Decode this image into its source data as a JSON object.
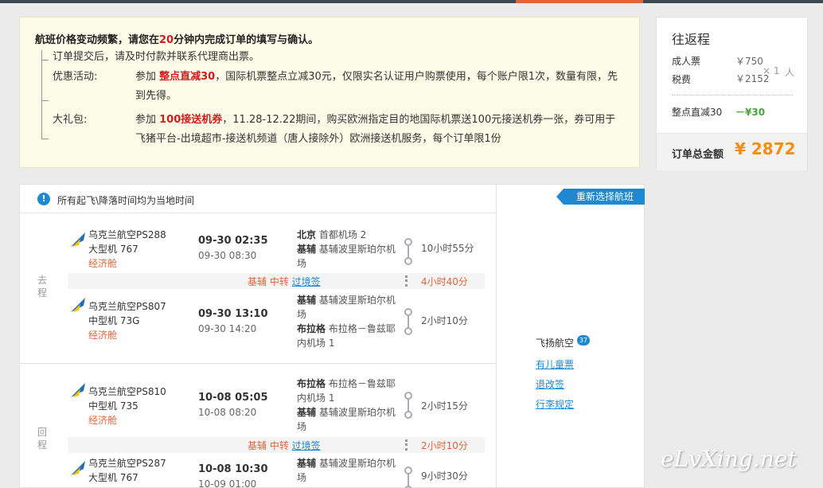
{
  "notice": {
    "title_pre": "航班价格变动频繁，请您在",
    "title_num": "20",
    "title_post": "分钟内完成订单的填写与确认。",
    "line1": "订单提交后，请及时付款并联系代理商出票。",
    "promo_label": "优惠活动:",
    "promo_pre": "参加 ",
    "promo_name": "整点直减30",
    "promo_text": "，国际机票整点立减30元，仅限实名认证用户购票使用，每个账户限1次，数量有限，先到先得。",
    "gift_label": "大礼包:",
    "gift_pre": "参加 ",
    "gift_name": "100接送机券",
    "gift_text": "，11.28-12.22期间，购买欧洲指定目的地国际机票送100元接送机券一张，券可用于飞猪平台-出境超市-接送机频道（唐人接除外）欧洲接送机服务，每个订单限1份"
  },
  "summary": {
    "heading": "往返程",
    "adult_label": "成人票",
    "adult_price": "￥750",
    "tax_label": "税费",
    "tax_price": "￥2152",
    "times": "×  1",
    "unit": "人",
    "discount_label": "整点直减30",
    "discount_value": "－¥30",
    "total_label": "订单总金额",
    "total_value": "¥ 2872"
  },
  "tz_notice": "所有起飞\\降落时间均为当地时间",
  "reselect": "重新选择航班",
  "outbound": {
    "label": "去程",
    "legs": [
      {
        "airline": "乌克兰航空PS288",
        "aircraft": "大型机 767",
        "cabin": "经济舱",
        "dep": "09-30 02:35",
        "arr": "09-30 08:30",
        "from_city": "北京",
        "from_apt": "首都机场 2",
        "to_city": "基辅",
        "to_apt": "基辅波里斯珀尔机场",
        "duration": "10小时55分"
      },
      {
        "airline": "乌克兰航空PS807",
        "aircraft": "中型机 73G",
        "cabin": "经济舱",
        "dep": "09-30 13:10",
        "arr": "09-30 14:20",
        "from_city": "基辅",
        "from_apt": "基辅波里斯珀尔机场",
        "to_city": "布拉格",
        "to_apt": "布拉格－鲁兹耶内机场 1",
        "duration": "2小时10分"
      }
    ],
    "transit": {
      "text": "基辅 中转 ",
      "link": "过境签",
      "duration": "4小时40分"
    }
  },
  "return": {
    "label": "回程",
    "legs": [
      {
        "airline": "乌克兰航空PS810",
        "aircraft": "中型机 735",
        "cabin": "经济舱",
        "dep": "10-08 05:05",
        "arr": "10-08 08:20",
        "from_city": "布拉格",
        "from_apt": "布拉格－鲁兹耶内机场 1",
        "to_city": "基辅",
        "to_apt": "基辅波里斯珀尔机场",
        "duration": "2小时15分"
      },
      {
        "airline": "乌克兰航空PS287",
        "aircraft": "大型机 767",
        "cabin": "经济舱",
        "dep": "10-08 10:30",
        "arr": "10-09 01:00",
        "from_city": "基辅",
        "from_apt": "基辅波里斯珀尔机场",
        "to_city": "",
        "to_apt": "",
        "duration": "9小时30分"
      }
    ],
    "transit": {
      "text": "基辅 中转 ",
      "link": "过境签",
      "duration": "2小时10分"
    }
  },
  "sidebar": {
    "agent": "飞扬航空",
    "badge": "37",
    "child_ticket": "有儿童票",
    "refund": "退改签",
    "baggage": "行李规定"
  },
  "watermark": "eLvXing.net",
  "colors": {
    "accent_blue": "#1e88d1",
    "price_orange": "#f88b12",
    "discount_green": "#49a43a",
    "alert_red": "#d21d1d"
  }
}
